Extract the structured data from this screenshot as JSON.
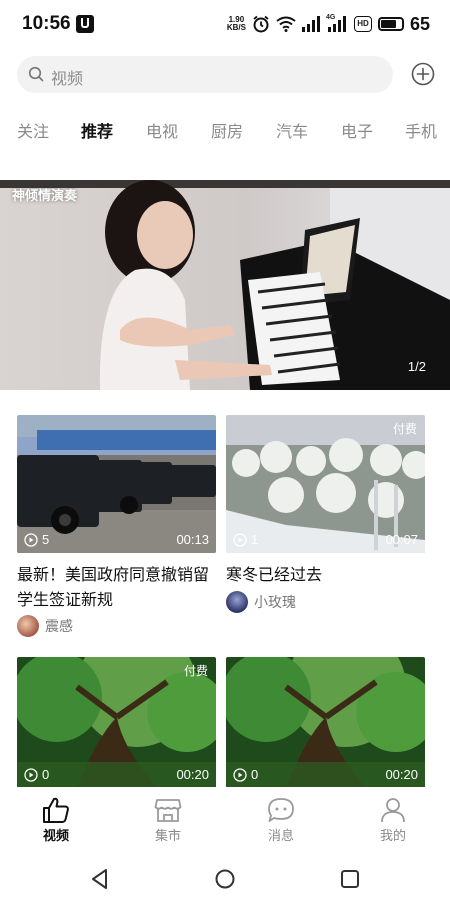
{
  "status_bar": {
    "time": "10:56",
    "net_speed_value": "1.90",
    "net_speed_unit": "KB/S",
    "network_badge": "4G",
    "hd_badge": "HD",
    "battery": "65"
  },
  "search": {
    "placeholder": "视频"
  },
  "tabs": [
    "关注",
    "推荐",
    "电视",
    "厨房",
    "汽车",
    "电子",
    "手机"
  ],
  "active_tab": "推荐",
  "banner": {
    "title": "神倾情演奏",
    "page_indicator": "1/2"
  },
  "cards": [
    {
      "views": "5",
      "duration": "00:13",
      "paid_label": "",
      "title": "最新！美国政府同意撤销留学生签证新规",
      "author": "震感"
    },
    {
      "views": "1",
      "duration": "00:07",
      "paid_label": "付费",
      "title": "寒冬已经过去",
      "author": "小玫瑰"
    },
    {
      "views": "0",
      "duration": "00:20",
      "paid_label": "付费",
      "title": "",
      "author": ""
    },
    {
      "views": "0",
      "duration": "00:20",
      "paid_label": "",
      "title": "",
      "author": ""
    }
  ],
  "bottom_nav": [
    {
      "label": "视频",
      "icon": "thumbs-up-icon",
      "active": true
    },
    {
      "label": "集市",
      "icon": "store-icon",
      "active": false
    },
    {
      "label": "消息",
      "icon": "chat-icon",
      "active": false
    },
    {
      "label": "我的",
      "icon": "person-icon",
      "active": false
    }
  ],
  "colors": {
    "active_text": "#111111",
    "inactive_text": "#8a8a8a",
    "search_bg": "#f2f2f3"
  }
}
